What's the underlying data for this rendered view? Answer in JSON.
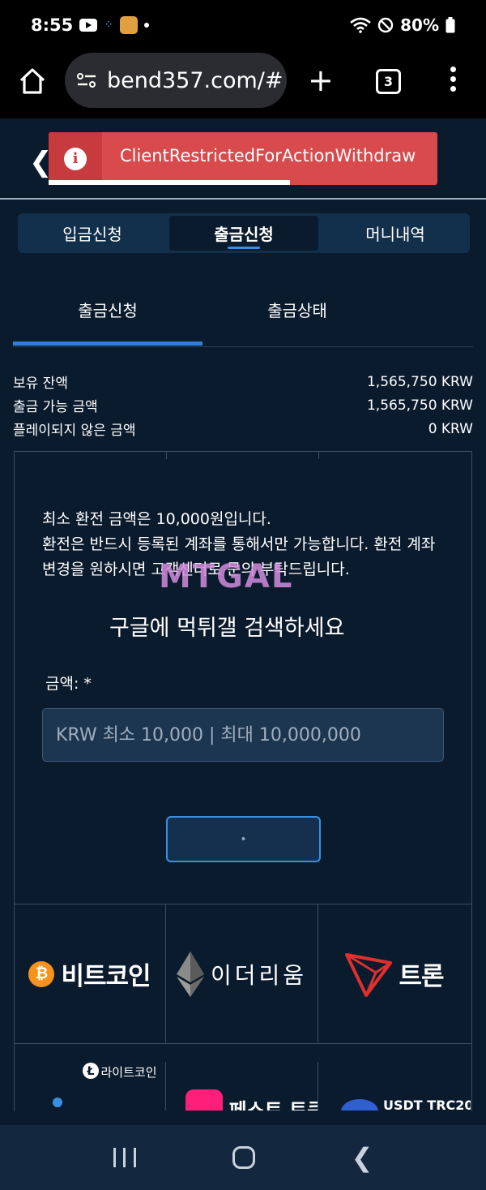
{
  "status_bar": {
    "time": "8:55",
    "battery": "80%"
  },
  "browser": {
    "url": "bend357.com/#",
    "tab_count": "3"
  },
  "toast": {
    "message": "ClientRestrictedForActionWithdraw",
    "progress": 0.62
  },
  "main_tabs": [
    {
      "label": "입금신청",
      "active": false
    },
    {
      "label": "출금신청",
      "active": true
    },
    {
      "label": "머니내역",
      "active": false
    }
  ],
  "sub_tabs": [
    {
      "label": "출금신청",
      "active": true
    },
    {
      "label": "출금상태",
      "active": false
    }
  ],
  "balances": [
    {
      "label": "보유 잔액",
      "value": "1,565,750 KRW"
    },
    {
      "label": "출금 가능 금액",
      "value": "1,565,750 KRW"
    },
    {
      "label": "플레이되지 않은 금액",
      "value": "0 KRW"
    }
  ],
  "notice": {
    "line1": "최소 환전 금액은 10,000원입니다.",
    "line2": "환전은 반드시 등록된 계좌를 통해서만 가능합니다. 환전 계좌 변경을 원하시면 고객센터로 문의 부탁드립니다."
  },
  "watermark": {
    "logo": "MTGAL",
    "text": "구글에 먹튀갤 검색하세요"
  },
  "form": {
    "amount_label": "금액: *",
    "amount_placeholder": "KRW 최소 10,000 | 최대 10,000,000",
    "submit_label": "•"
  },
  "coins": [
    {
      "name": "비트코인",
      "icon": "bitcoin-icon",
      "color": "#f7931a"
    },
    {
      "name": "이더리움",
      "icon": "ethereum-icon",
      "color": "#8c8c8c"
    },
    {
      "name": "트론",
      "icon": "tron-icon",
      "color": "#e0302e"
    }
  ],
  "coins_partial": [
    {
      "name": "라이트코인",
      "icon": "litecoin-icon"
    },
    {
      "name": "페스트 토큰",
      "icon": "fast-token-icon"
    },
    {
      "name": "USDT TRC20",
      "icon": "usdt-icon"
    }
  ]
}
